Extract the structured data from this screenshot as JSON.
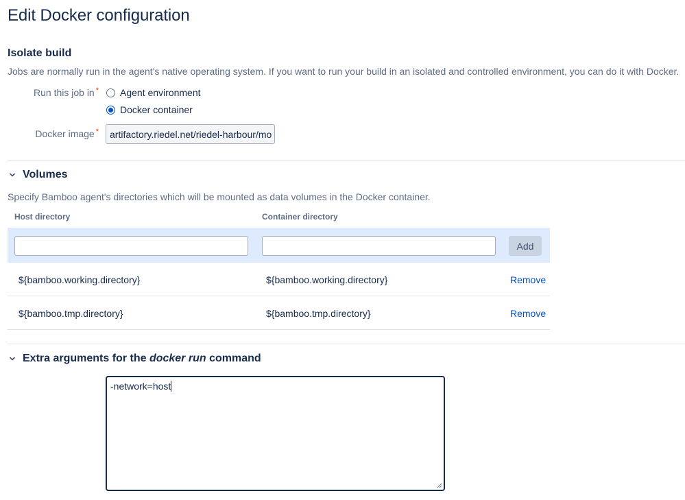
{
  "page": {
    "title": "Edit Docker configuration"
  },
  "isolate": {
    "heading": "Isolate build",
    "description": "Jobs are normally run in the agent's native operating system. If you want to run your build in an isolated and controlled environment, you can do it with Docker.",
    "run_label": "Run this job in",
    "options": [
      {
        "label": "Agent environment",
        "checked": false
      },
      {
        "label": "Docker container",
        "checked": true
      }
    ],
    "image_label": "Docker image",
    "image_value": "artifactory.riedel.net/riedel-harbour/mo"
  },
  "volumes": {
    "heading": "Volumes",
    "description": "Specify Bamboo agent's directories which will be mounted as data volumes in the Docker container.",
    "col_host": "Host directory",
    "col_container": "Container directory",
    "host_input_value": "",
    "container_input_value": "",
    "add_label": "Add",
    "rows": [
      {
        "host": "${bamboo.working.directory}",
        "container": "${bamboo.working.directory}",
        "action": "Remove"
      },
      {
        "host": "${bamboo.tmp.directory}",
        "container": "${bamboo.tmp.directory}",
        "action": "Remove"
      }
    ]
  },
  "extra": {
    "heading_pre": "Extra arguments for the ",
    "heading_em": "docker run",
    "heading_post": " command",
    "value": "-network=host"
  }
}
